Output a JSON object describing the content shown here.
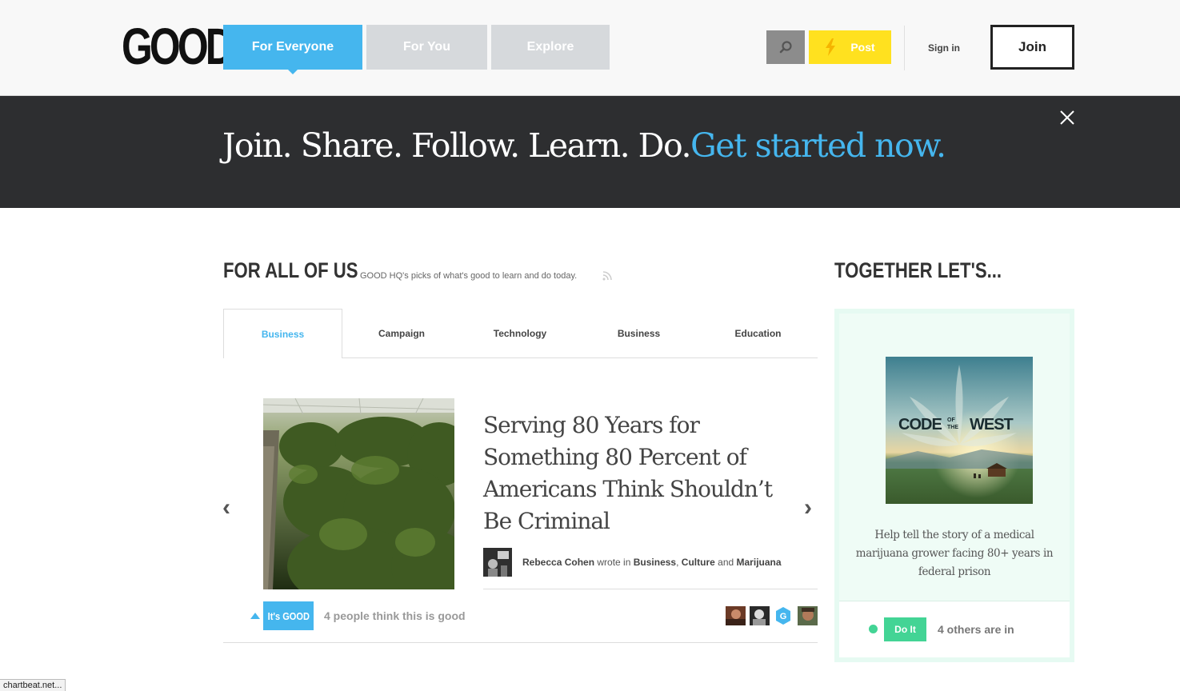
{
  "header": {
    "logo": "GOOD",
    "tabs": [
      {
        "label": "For Everyone",
        "active": true
      },
      {
        "label": "For You",
        "active": false
      },
      {
        "label": "Explore",
        "active": false
      }
    ],
    "search_icon": "search-icon",
    "post_label": "Post",
    "post_icon": "lightning-icon",
    "signin_label": "Sign in",
    "join_label": "Join"
  },
  "banner": {
    "text": "Join. Share. Follow. Learn. Do.",
    "cta": "Get started now.",
    "close_icon": "close-icon"
  },
  "main": {
    "title": "FOR ALL OF US",
    "subtitle": "GOOD HQ's picks of what's good to learn and do today.",
    "tabs": [
      "Business",
      "Campaign",
      "Technology",
      "Business",
      "Education"
    ],
    "active_tab": 0,
    "article": {
      "title": "Serving 80 Years for Something 80 Percent of Americans Think Shouldn’t Be Criminal",
      "author": "Rebecca Cohen",
      "wrote_in": "wrote in",
      "cat1": "Business",
      "sep": ",",
      "cat2": "Culture",
      "and": "and",
      "cat3": "Marijuana",
      "vote_label": "It's GOOD",
      "vote_count_text": "4 people think this is good",
      "prev_icon": "chevron-left-icon",
      "next_icon": "chevron-right-icon"
    }
  },
  "sidebar": {
    "title": "TOGETHER LET'S...",
    "card": {
      "image_text_1": "CODE",
      "image_text_of": "OF",
      "image_text_the": "THE",
      "image_text_2": "WEST",
      "description": "Help tell the story of a medical marijuana grower facing 80+ years in federal prison",
      "do_label": "Do It",
      "others_text": "4 others are in"
    }
  },
  "status_bar": "chartbeat.net...",
  "colors": {
    "accent_blue": "#45b6ee",
    "post_yellow": "#ffe11f",
    "banner_dark": "#2d2e30",
    "do_green": "#43d495"
  }
}
